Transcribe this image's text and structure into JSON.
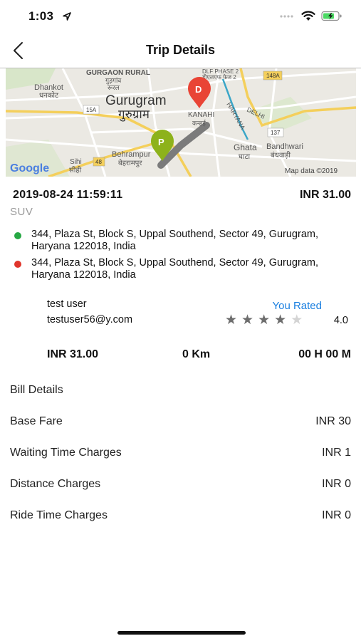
{
  "status_bar": {
    "time": "1:03"
  },
  "header": {
    "title": "Trip Details"
  },
  "map": {
    "labels": {
      "gurgaon_rural": "GURGAON RURAL",
      "gurgaon_rural_hi": "गुड़गांव",
      "gurgaon_rural_hi2": "रूरल",
      "dlf_phase2": "DLF PHASE 2",
      "dlf_hi": "डीएलएफ फेज 2",
      "hwy_148a": "148A",
      "dhankot": "Dhankot",
      "dhankot_hi": "धनकोट",
      "gurugram": "Gurugram",
      "gurugram_hi": "गुरुग्राम",
      "delhi": "DELHI",
      "haryana": "HARYANA",
      "kanahi": "KANAHI",
      "kanahi_hi": "कन्हई",
      "hwy_15a": "15A",
      "hwy_137": "137",
      "behrampur": "Behrampur",
      "behrampur_hi": "बेहरामपुर",
      "ghata": "Ghata",
      "ghata_hi": "घाटा",
      "bandhwari": "Bandhwari",
      "bandhwari_hi": "बंधवाड़ी",
      "sihi": "Sihi",
      "sihi_hi": "सीही",
      "hwy_48": "48",
      "google": "Google",
      "map_data": "Map data ©2019",
      "marker_pickup": "P",
      "marker_drop": "D"
    }
  },
  "trip": {
    "datetime": "2019-08-24 11:59:11",
    "fare": "INR 31.00",
    "vehicle": "SUV",
    "pickup_address": "344, Plaza St, Block S, Uppal Southend, Sector 49, Gurugram, Haryana 122018, India",
    "drop_address": "344, Plaza St, Block S, Uppal Southend, Sector 49, Gurugram, Haryana 122018, India",
    "pickup_color": "#27a844",
    "drop_color": "#e0362c"
  },
  "user": {
    "name": "test user",
    "email": "testuser56@y.com",
    "rated_label": "You Rated",
    "rating": 4.0,
    "rating_text": "4.0",
    "stars_max": 5
  },
  "summary": {
    "fare": "INR 31.00",
    "distance": "0 Km",
    "duration": "00 H 00 M"
  },
  "bill": {
    "title": "Bill Details",
    "rows": [
      {
        "label": "Base Fare",
        "value": "INR 30"
      },
      {
        "label": "Waiting Time Charges",
        "value": "INR 1"
      },
      {
        "label": "Distance Charges",
        "value": "INR 0"
      },
      {
        "label": "Ride Time Charges",
        "value": "INR 0"
      }
    ]
  },
  "colors": {
    "accent": "#1a7fe0",
    "marker_drop": "#e94435",
    "marker_pickup": "#8db21b"
  }
}
